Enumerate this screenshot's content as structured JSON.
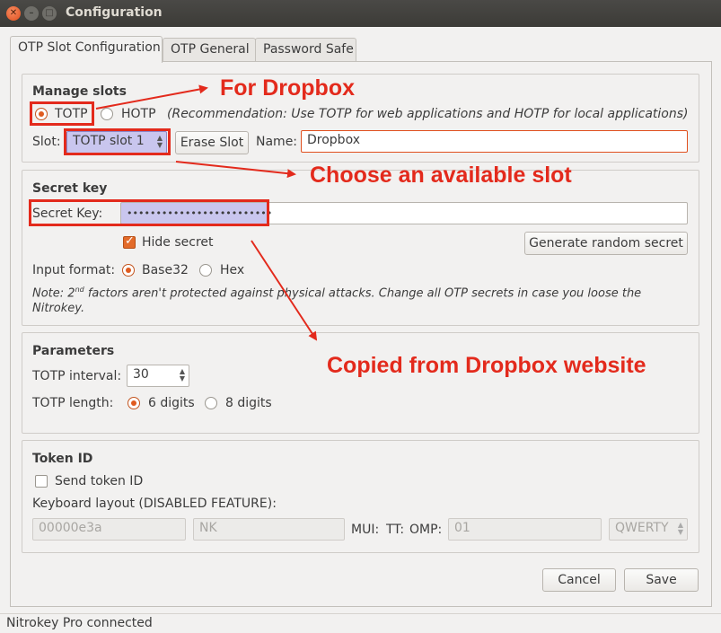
{
  "window": {
    "title": "Configuration"
  },
  "tabs": [
    {
      "label": "OTP Slot Configuration"
    },
    {
      "label": "OTP General"
    },
    {
      "label": "Password Safe"
    }
  ],
  "manage_slots": {
    "title": "Manage slots",
    "totp_label": "TOTP",
    "hotp_label": "HOTP",
    "recommendation": "(Recommendation: Use TOTP for web applications and HOTP for local applications)",
    "slot_label": "Slot:",
    "slot_value": "TOTP slot 1",
    "erase_button": "Erase Slot",
    "name_label": "Name:",
    "name_value": "Dropbox"
  },
  "secret_key": {
    "title": "Secret key",
    "label": "Secret Key:",
    "value": "•••••••••••••••••••••••••",
    "hide_secret": "Hide secret",
    "generate_button": "Generate random secret",
    "input_format_label": "Input format:",
    "base32": "Base32",
    "hex": "Hex",
    "note_prefix": "Note: 2",
    "note_sup": "nd",
    "note_rest": " factors aren't protected against physical attacks. Change all OTP secrets in case you loose the",
    "note_line2": "Nitrokey."
  },
  "parameters": {
    "title": "Parameters",
    "interval_label": "TOTP interval:",
    "interval_value": "30",
    "length_label": "TOTP length:",
    "six_digits": "6 digits",
    "eight_digits": "8 digits"
  },
  "token_id": {
    "title": "Token ID",
    "send_token": "Send token ID",
    "keyboard_layout": "Keyboard layout (DISABLED FEATURE):",
    "field1": "00000e3a",
    "field2": "NK",
    "mui_label": "MUI:",
    "tt_label": "TT:",
    "omp_label": "OMP:",
    "omp_value": "01",
    "layout_value": "QWERTY"
  },
  "buttons": {
    "cancel": "Cancel",
    "save": "Save"
  },
  "status": "Nitrokey Pro connected",
  "annotations": {
    "for_dropbox": "For Dropbox",
    "choose_slot": "Choose an available slot",
    "copied": "Copied from Dropbox website"
  },
  "colors": {
    "annotation": "#e32a1c",
    "accent": "#e05b1f",
    "highlight": "#c9c6ee"
  }
}
